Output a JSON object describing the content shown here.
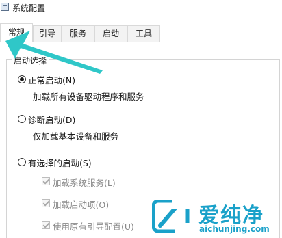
{
  "window": {
    "title": "系统配置",
    "accent_color": "#2fc7c8"
  },
  "tabs": [
    {
      "label": "常规",
      "active": true
    },
    {
      "label": "引导",
      "active": false
    },
    {
      "label": "服务",
      "active": false
    },
    {
      "label": "启动",
      "active": false
    },
    {
      "label": "工具",
      "active": false
    }
  ],
  "startup_group": {
    "label": "启动选择",
    "options": [
      {
        "label": "正常启动(N)",
        "description": "加载所有设备驱动程序和服务",
        "checked": true
      },
      {
        "label": "诊断启动(D)",
        "description": "仅加载基本设备和服务",
        "checked": false
      },
      {
        "label": "有选择的启动(S)",
        "description": "",
        "checked": false
      }
    ],
    "sub_options": [
      {
        "label": "加载系统服务(L)",
        "checked": true,
        "enabled": false
      },
      {
        "label": "加载启动项(O)",
        "checked": true,
        "enabled": false
      },
      {
        "label": "使用原有引导配置(U)",
        "checked": true,
        "enabled": false
      }
    ]
  },
  "watermark": {
    "brand": "爱纯净",
    "url": "aichunjing.com",
    "color": "#1aa1c9"
  }
}
